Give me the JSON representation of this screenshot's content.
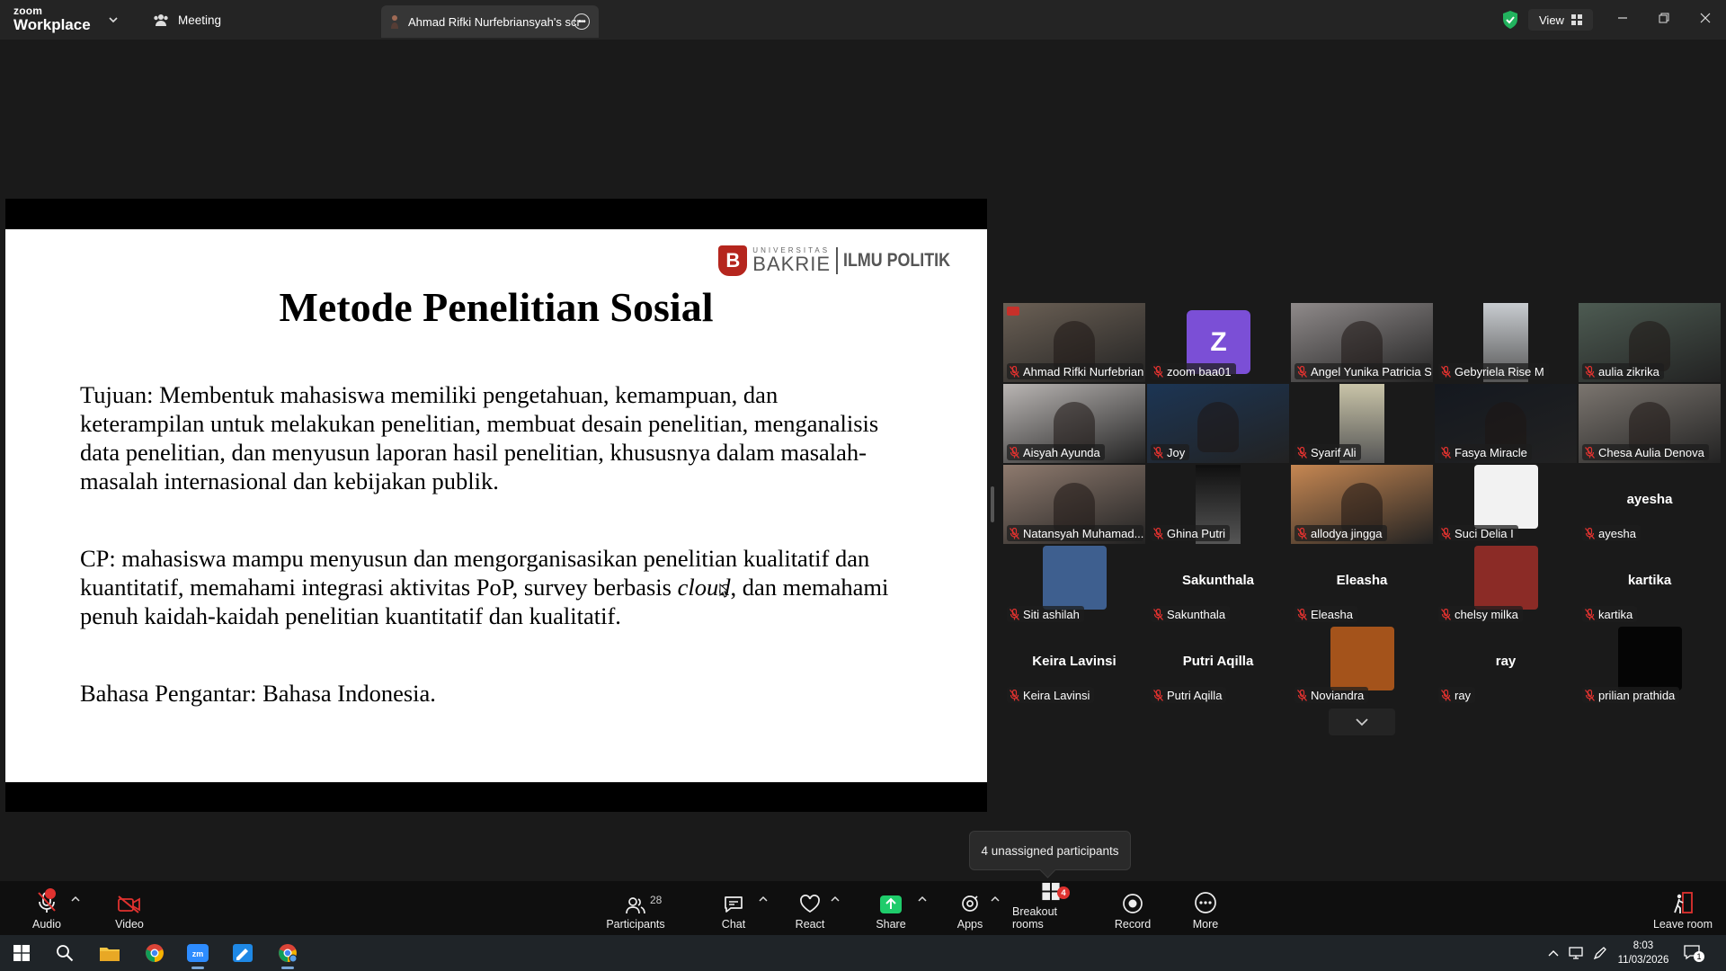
{
  "titlebar": {
    "brand_top": "zoom",
    "brand_bottom": "Workplace",
    "meeting_label": "Meeting",
    "share_tab_label": "Ahmad Rifki Nurfebriansyah's scr",
    "view_label": "View"
  },
  "slide": {
    "logo_small": "UNIVERSITAS",
    "logo_big": "BAKRIE",
    "logo_dept": "ILMU POLITIK",
    "title": "Metode Penelitian Sosial",
    "p1": "Tujuan: Membentuk mahasiswa memiliki pengetahuan, kemampuan, dan keterampilan untuk melakukan penelitian, membuat desain penelitian, menganalisis data penelitian, dan menyusun laporan hasil penelitian, khususnya dalam masalah-masalah internasional dan kebijakan publik.",
    "p2_before": "CP: mahasiswa mampu menyusun dan mengorganisasikan penelitian kualitatif dan kuantitatif, memahami integrasi aktivitas PoP, survey berbasis ",
    "p2_italic": "cloud",
    "p2_after": ", dan memahami penuh kaidah-kaidah penelitian kuantitatif dan kualitatif.",
    "p3": "Bahasa Pengantar: Bahasa Indonesia."
  },
  "participants": [
    {
      "name": "Ahmad Rifki Nurfebrians...",
      "style": "video",
      "bg": "#6b6055",
      "active": true
    },
    {
      "name": "zoom baa01",
      "style": "avatar",
      "initial": "Z",
      "bg": "#7b4fd6"
    },
    {
      "name": "Angel Yunika Patricia S",
      "style": "video",
      "bg": "#8f8a8a"
    },
    {
      "name": "Gebyriela Rise M",
      "style": "video-narrow",
      "bg": "#c8ccd0"
    },
    {
      "name": "aulia zikrika",
      "style": "video",
      "bg": "#4d5b52"
    },
    {
      "name": "Aisyah Ayunda",
      "style": "video",
      "bg": "#b9b5b3"
    },
    {
      "name": "Joy",
      "style": "video",
      "bg": "#1c3554"
    },
    {
      "name": "Syarif Ali",
      "style": "video-narrow",
      "bg": "#c9c4a8"
    },
    {
      "name": "Fasya Miracle",
      "style": "video",
      "bg": "#14181f"
    },
    {
      "name": "Chesa Aulia Denova",
      "style": "video",
      "bg": "#7b756f"
    },
    {
      "name": "Natansyah Muhamad...",
      "style": "video",
      "bg": "#8e7a6e"
    },
    {
      "name": "Ghina Putri",
      "style": "video-narrow",
      "bg": "#0f0f0f"
    },
    {
      "name": "allodya jingga",
      "style": "video",
      "bg": "#c68752"
    },
    {
      "name": "Suci Delia I",
      "style": "picture",
      "bg": "#f2f2f2"
    },
    {
      "name": "ayesha",
      "style": "name",
      "big": "ayesha"
    },
    {
      "name": "Siti ashilah",
      "style": "picture",
      "bg": "#3e5f8f"
    },
    {
      "name": "Sakunthala",
      "style": "name",
      "big": "Sakunthala"
    },
    {
      "name": "Eleasha",
      "style": "name",
      "big": "Eleasha"
    },
    {
      "name": "chelsy milka",
      "style": "picture",
      "bg": "#8b2b26"
    },
    {
      "name": "kartika",
      "style": "name",
      "big": "kartika"
    },
    {
      "name": "Keira Lavinsi",
      "style": "name",
      "big": "Keira Lavinsi"
    },
    {
      "name": "Putri Aqilla",
      "style": "name",
      "big": "Putri Aqilla"
    },
    {
      "name": "Noviandra",
      "style": "picture",
      "bg": "#a4531b"
    },
    {
      "name": "ray",
      "style": "name",
      "big": "ray"
    },
    {
      "name": "prilian prathida",
      "style": "picture",
      "bg": "#050505"
    }
  ],
  "tooltip": "4 unassigned participants",
  "toolbar": {
    "audio": "Audio",
    "video": "Video",
    "participants": "Participants",
    "participants_count": "28",
    "chat": "Chat",
    "react": "React",
    "share": "Share",
    "apps": "Apps",
    "breakout": "Breakout rooms",
    "breakout_badge": "4",
    "record": "Record",
    "more": "More",
    "leave": "Leave room"
  },
  "taskbar": {
    "time": "8:03",
    "date": "11/03/2026",
    "notif": "1"
  },
  "colors": {
    "accent_green": "#2ecc71",
    "share_green": "#1fcc6b",
    "alert_red": "#e0322f",
    "brand_red": "#b5261e"
  }
}
